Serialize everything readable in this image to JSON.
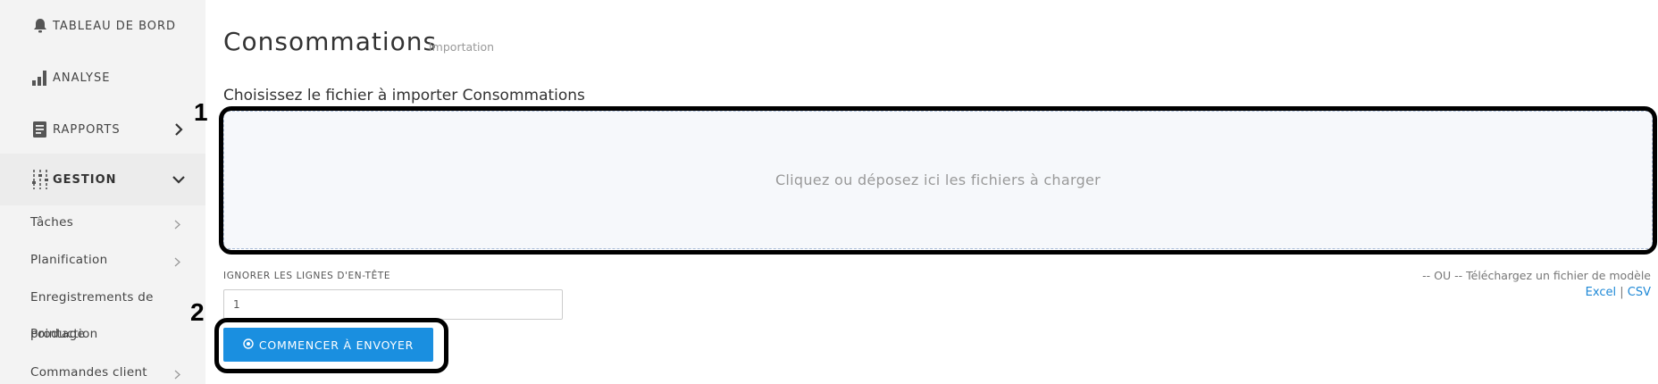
{
  "sidebar": {
    "items": [
      {
        "label": "TABLEAU DE BORD",
        "icon": "bell-icon"
      },
      {
        "label": "ANALYSE",
        "icon": "bar-chart-icon"
      },
      {
        "label": "RAPPORTS",
        "icon": "report-icon"
      },
      {
        "label": "GESTION",
        "icon": "sliders-icon"
      }
    ],
    "sub_items": [
      {
        "label": "Tâches"
      },
      {
        "label": "Planification"
      },
      {
        "label": "Enregistrements de"
      },
      {
        "label": "production",
        "overlap": "Pointage"
      },
      {
        "label": "Commandes client"
      }
    ]
  },
  "main": {
    "title": "Consommations",
    "subtitle": "Importation",
    "choose_label": "Choisissez le fichier à importer Consommations",
    "dropzone_text": "Cliquez ou déposez ici les fichiers à charger",
    "ignore_label": "IGNORER LES LIGNES D'EN-TÊTE",
    "ignore_value": "1",
    "or_text": "-- OU -- Téléchargez un fichier de modèle",
    "link_excel": "Excel",
    "link_sep": "|",
    "link_csv": "CSV",
    "start_button": "COMMENCER À ENVOYER"
  },
  "annotations": {
    "marker_1": "1",
    "marker_2": "2"
  },
  "colors": {
    "sidebar_bg": "#f3f3f3",
    "accent": "#1a8fe0",
    "link": "#1e88d6"
  }
}
